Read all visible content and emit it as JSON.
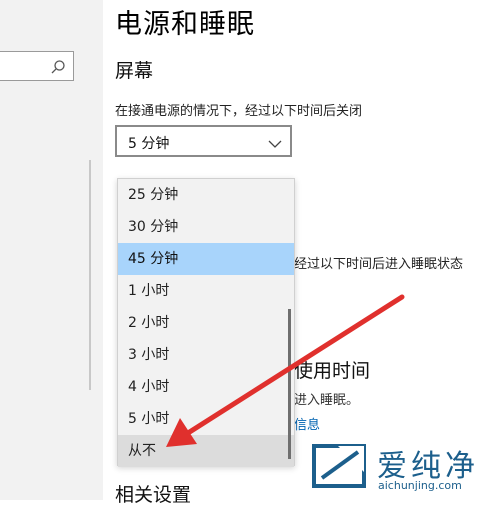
{
  "page": {
    "title": "电源和睡眠",
    "screen_section": "屏幕",
    "screen_off_label": "在接通电源的情况下，经过以下时间后关闭",
    "screen_off_value": "5 分钟",
    "sleep_label_partial": "经过以下时间后进入睡眠状态",
    "sub_title_partial": "使用时间",
    "sub_desc_partial": "进入睡眠。",
    "sub_link_partial": "信息",
    "related_section": "相关设置"
  },
  "dropdown": {
    "options": [
      {
        "label": "25 分钟"
      },
      {
        "label": "30 分钟"
      },
      {
        "label": "45 分钟"
      },
      {
        "label": "1 小时"
      },
      {
        "label": "2 小时"
      },
      {
        "label": "3 小时"
      },
      {
        "label": "4 小时"
      },
      {
        "label": "5 小时"
      },
      {
        "label": "从不"
      }
    ],
    "selected_value": "45 分钟",
    "hover_value": "从不"
  },
  "watermark": {
    "text": "爱纯净",
    "url": "aichunjing.com"
  },
  "colors": {
    "selected_option_bg": "#a8d4fb",
    "link_blue": "#0063b1",
    "annotation_arrow": "#e0302d",
    "watermark_blue": "#1c5f8c"
  }
}
